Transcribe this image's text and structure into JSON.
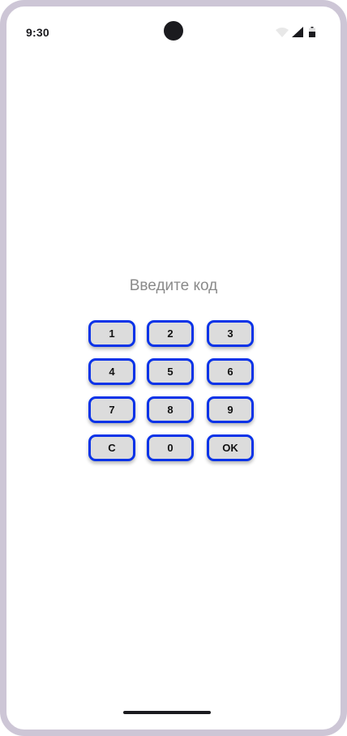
{
  "status_bar": {
    "time": "9:30",
    "icons": [
      "wifi-icon",
      "signal-icon",
      "battery-icon"
    ]
  },
  "prompt": "Введите код",
  "keypad": {
    "keys": [
      "1",
      "2",
      "3",
      "4",
      "5",
      "6",
      "7",
      "8",
      "9",
      "C",
      "0",
      "OK"
    ]
  },
  "colors": {
    "frame": "#cdc6d6",
    "key_border": "#0a33e8",
    "key_fill": "#dcdcdc",
    "prompt_text": "#8a8a8a"
  }
}
